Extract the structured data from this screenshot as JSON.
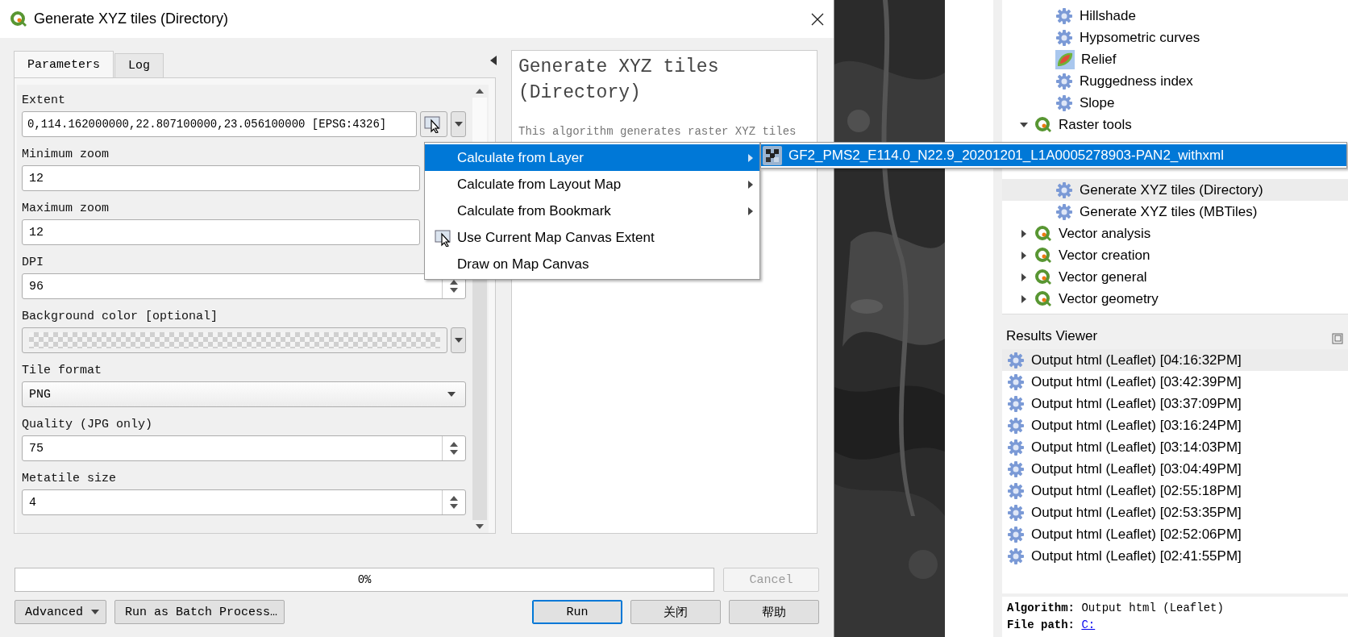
{
  "dialog": {
    "title": "Generate XYZ tiles (Directory)",
    "tabs": [
      {
        "label": "Parameters",
        "selected": true
      },
      {
        "label": "Log",
        "selected": false
      }
    ],
    "parameters": [
      {
        "kind": "extent",
        "label": "Extent",
        "value": "0,114.162000000,22.807100000,23.056100000 [EPSG:4326]"
      },
      {
        "kind": "field",
        "label": "Minimum zoom",
        "value": "12"
      },
      {
        "kind": "field",
        "label": "Maximum zoom",
        "value": "12"
      },
      {
        "kind": "spin",
        "label": "DPI",
        "value": "96"
      },
      {
        "kind": "color",
        "label": "Background color [optional]"
      },
      {
        "kind": "combo",
        "label": "Tile format",
        "value": "PNG"
      },
      {
        "kind": "spin",
        "label": "Quality (JPG only)",
        "value": "75"
      },
      {
        "kind": "spin",
        "label": "Metatile size",
        "value": "4"
      }
    ],
    "help": {
      "title": "Generate XYZ tiles (Directory)",
      "text": "This algorithm generates raster XYZ tiles"
    },
    "progress": {
      "level": 0,
      "label": "0%"
    },
    "cancel": {
      "label": "Cancel",
      "disabled": true
    },
    "left_buttons": [
      {
        "kind": "dropdown",
        "label": "Advanced"
      },
      {
        "kind": "plain",
        "label": "Run as Batch Process…"
      }
    ],
    "right_buttons": [
      {
        "label": "Run",
        "selected": true
      },
      {
        "label": "关闭",
        "selected": false
      },
      {
        "label": "帮助",
        "selected": false
      }
    ]
  },
  "extent_menu": {
    "items": [
      {
        "kind": "submenu",
        "label": "Calculate from Layer",
        "selected": true
      },
      {
        "kind": "submenu",
        "label": "Calculate from Layout Map",
        "selected": false
      },
      {
        "kind": "submenu",
        "label": "Calculate from Bookmark",
        "selected": false
      },
      {
        "kind": "icon-action",
        "label": "Use Current Map Canvas Extent",
        "selected": false
      },
      {
        "kind": "action",
        "label": "Draw on Map Canvas",
        "selected": false
      }
    ],
    "submenu": [
      {
        "label": "GF2_PMS2_E114.0_N22.9_20201201_L1A0005278903-PAN2_withxml",
        "selected": true
      }
    ]
  },
  "toolbox": {
    "items": [
      {
        "kind": "tool",
        "label": "Hillshade",
        "selected": false
      },
      {
        "kind": "tool",
        "label": "Hypsometric curves",
        "selected": false
      },
      {
        "kind": "relief-tool",
        "label": "Relief",
        "selected": false
      },
      {
        "kind": "tool",
        "label": "Ruggedness index",
        "selected": false
      },
      {
        "kind": "tool",
        "label": "Slope",
        "selected": false
      },
      {
        "kind": "group",
        "label": "Raster tools",
        "expanded": true,
        "children": [
          {
            "kind": "tool",
            "label": "Generate XYZ tiles (Directory)",
            "selected": true
          },
          {
            "kind": "tool",
            "label": "Generate XYZ tiles (MBTiles)",
            "selected": false
          }
        ]
      },
      {
        "kind": "group",
        "label": "Vector analysis",
        "expanded": false
      },
      {
        "kind": "group",
        "label": "Vector creation",
        "expanded": false
      },
      {
        "kind": "group",
        "label": "Vector general",
        "expanded": false
      },
      {
        "kind": "group",
        "label": "Vector geometry",
        "expanded": false
      }
    ]
  },
  "results_viewer": {
    "title": "Results Viewer",
    "items": [
      {
        "label": "Output html (Leaflet) [04:16:32PM]",
        "selected": true
      },
      {
        "label": "Output html (Leaflet) [03:42:39PM]",
        "selected": false
      },
      {
        "label": "Output html (Leaflet) [03:37:09PM]",
        "selected": false
      },
      {
        "label": "Output html (Leaflet) [03:16:24PM]",
        "selected": false
      },
      {
        "label": "Output html (Leaflet) [03:14:03PM]",
        "selected": false
      },
      {
        "label": "Output html (Leaflet) [03:04:49PM]",
        "selected": false
      },
      {
        "label": "Output html (Leaflet) [02:55:18PM]",
        "selected": false
      },
      {
        "label": "Output html (Leaflet) [02:53:35PM]",
        "selected": false
      },
      {
        "label": "Output html (Leaflet) [02:52:06PM]",
        "selected": false
      },
      {
        "label": "Output html (Leaflet) [02:41:55PM]",
        "selected": false
      }
    ],
    "details": {
      "algorithm_label": "Algorithm:",
      "algorithm": "Output html (Leaflet)",
      "path_label": "File path:",
      "path": "C:"
    }
  }
}
